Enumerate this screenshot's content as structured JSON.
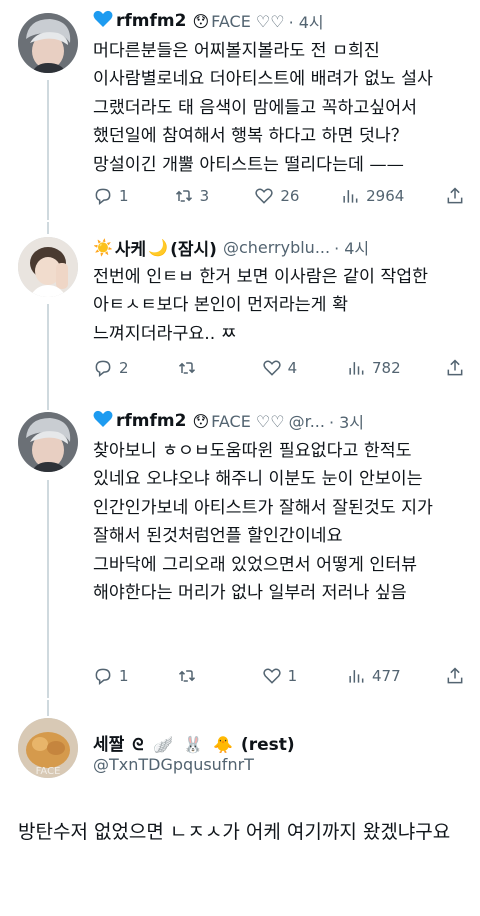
{
  "tweets": [
    {
      "name": "rfmfm2",
      "tag": "FACE ♡♡",
      "dot_time": "· 4시",
      "body": "머다른분들은 어찌볼지볼라도 전 ㅁ희진 이사람별로네요 더아티스트에 배려가 없노 설사 그랬더라도 태 음색이 맘에들고 꼭하고싶어서 했던일에 참여해서 행복 하다고 하면 덧나？ 망설이긴 개뿔 아티스트는 떨리다는데 ——",
      "replies": "1",
      "retweets": "3",
      "likes": "26",
      "views": "2964"
    },
    {
      "name": "사케",
      "name_suffix": "(잠시)",
      "handle": "@cherryblu...",
      "dot_time": "· 4시",
      "body": "전번에 인ㅌㅂ 한거 보면 이사람은 같이 작업한 아ㅌㅅㅌ보다 본인이 먼저라는게 확 느껴지더라구요.. ㅉ",
      "replies": "2",
      "retweets": "",
      "likes": "4",
      "views": "782"
    },
    {
      "name": "rfmfm2",
      "tag": "FACE ♡♡",
      "handle": "@r...",
      "dot_time": "· 3시",
      "body": "찾아보니 ㅎㅇㅂ도움따윈 필요없다고 한적도 있네요 오냐오냐 해주니 이분도 눈이 안보이는 인간인가보네 아티스트가 잘해서 잘된것도 지가 잘해서 된것처럼언플 할인간이네요\n그바닥에 그리오래 있었으면서 어떻게 인터뷰 해야한다는 머리가 없나 일부러 저러나 싶음",
      "replies": "1",
      "retweets": "",
      "likes": "1",
      "views": "477"
    }
  ],
  "quote": {
    "name": "세짤",
    "name_suffix": "(rest)",
    "handle": "@TxnTDGpqusufnrT",
    "body": "방탄수저 없었으면 ㄴㅈㅅ가 어케 여기까지 왔겠냐구요"
  },
  "colors": {
    "heart": "#1d9bf0",
    "muted": "#536471",
    "text": "#0f1419",
    "line": "#cfd9de"
  }
}
